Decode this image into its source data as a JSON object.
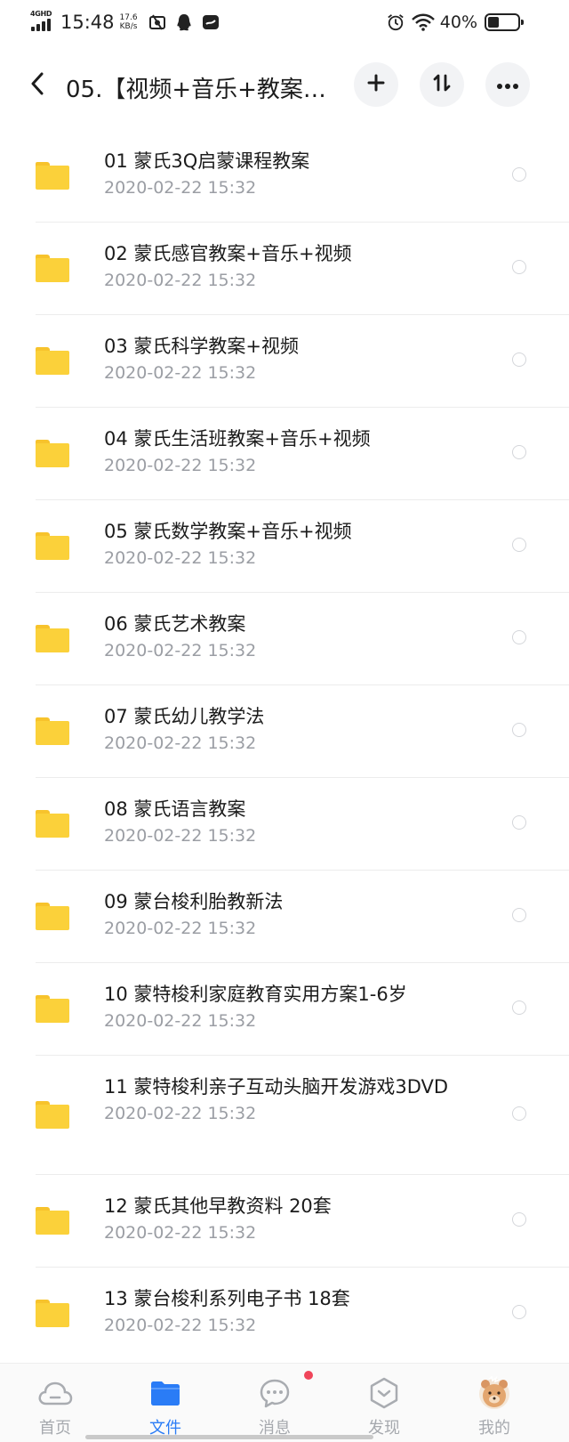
{
  "status_bar": {
    "network_type": "4GHD",
    "time": "15:48",
    "speed_value": "17.6",
    "speed_unit": "KB/s",
    "battery_percent": "40%",
    "battery_level": 0.4
  },
  "header": {
    "title": "05.【视频+音乐+教案…",
    "icons": [
      "back-icon",
      "plus-icon",
      "sort-icon",
      "more-icon"
    ]
  },
  "files": [
    {
      "name": "01  蒙氏3Q启蒙课程教案",
      "date": "2020-02-22  15:32"
    },
    {
      "name": "02  蒙氏感官教案+音乐+视频",
      "date": "2020-02-22  15:32"
    },
    {
      "name": "03  蒙氏科学教案+视频",
      "date": "2020-02-22  15:32"
    },
    {
      "name": "04  蒙氏生活班教案+音乐+视频",
      "date": "2020-02-22  15:32"
    },
    {
      "name": "05  蒙氏数学教案+音乐+视频",
      "date": "2020-02-22  15:32"
    },
    {
      "name": "06  蒙氏艺术教案",
      "date": "2020-02-22  15:32"
    },
    {
      "name": "07  蒙氏幼儿教学法",
      "date": "2020-02-22  15:32"
    },
    {
      "name": "08  蒙氏语言教案",
      "date": "2020-02-22  15:32"
    },
    {
      "name": "09  蒙台梭利胎教新法",
      "date": "2020-02-22  15:32"
    },
    {
      "name": "10  蒙特梭利家庭教育实用方案1-6岁",
      "date": "2020-02-22  15:32"
    },
    {
      "name": "11  蒙特梭利亲子互动头脑开发游戏3DVD",
      "date": "2020-02-22  15:32"
    },
    {
      "name": "12 蒙氏其他早教资料 20套",
      "date": "2020-02-22  15:32"
    },
    {
      "name": "13 蒙台梭利系列电子书 18套",
      "date": "2020-02-22  15:32"
    }
  ],
  "bottom_nav": [
    {
      "label": "首页",
      "icon": "cloud-icon",
      "active": false
    },
    {
      "label": "文件",
      "icon": "folder-icon",
      "active": true
    },
    {
      "label": "消息",
      "icon": "chat-bubble-icon",
      "active": false
    },
    {
      "label": "发现",
      "icon": "hexagon-icon",
      "active": false
    },
    {
      "label": "我的",
      "icon": "avatar-icon",
      "active": false
    }
  ],
  "colors": {
    "accent": "#2a7cf6",
    "folder": "#fbd13a",
    "badge": "#f0455a"
  }
}
